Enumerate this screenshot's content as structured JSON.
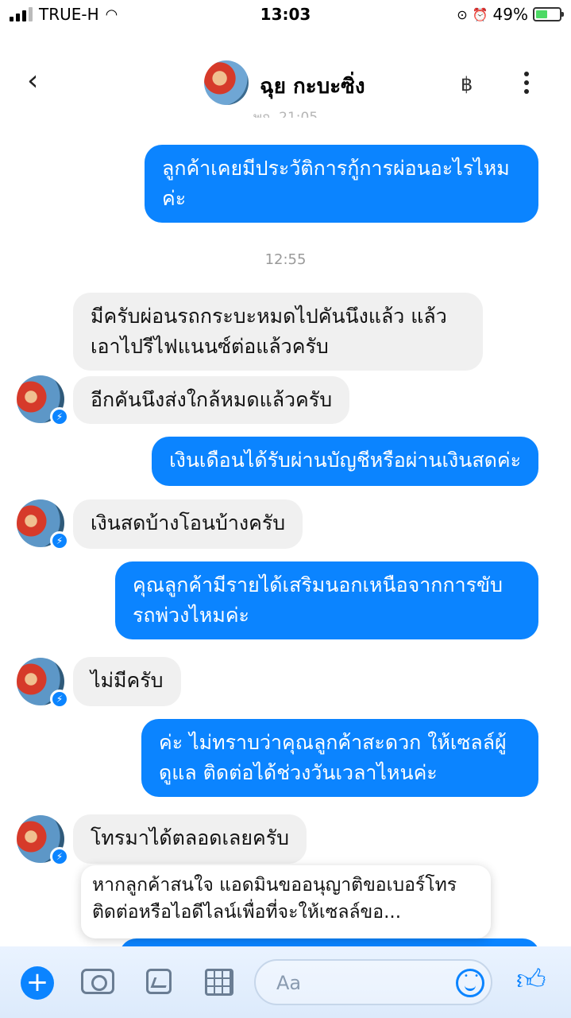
{
  "status_bar": {
    "carrier": "TRUE-H",
    "time": "13:03",
    "battery_percent": "49%",
    "battery_level": 0.49
  },
  "header": {
    "back_icon": "chevron-left-icon",
    "contact_name": "ฉุย กะบะซิ่ง",
    "baht_symbol": "฿",
    "partial_timestamp": "พฤ. 21:05"
  },
  "messages": [
    {
      "side": "out",
      "text": "ลูกค้าเคยมีประวัติการกู้การผ่อนอะไรไหมค่ะ"
    },
    {
      "side": "timestamp",
      "text": "12:55"
    },
    {
      "side": "in",
      "text": "มีครับผ่อนรถกระบะหมดไปคันนึงแล้ว แล้วเอาไปรีไฟแนนซ์ต่อแล้วครับ"
    },
    {
      "side": "in",
      "text": "อีกคันนึงส่งใกล้หมดแล้วครับ"
    },
    {
      "side": "out",
      "text": "เงินเดือนได้รับผ่านบัญชีหรือผ่านเงินสดค่ะ"
    },
    {
      "side": "in",
      "text": "เงินสดบ้างโอนบ้างครับ"
    },
    {
      "side": "out",
      "text": "คุณลูกค้ามีรายได้เสริมนอกเหนือจากการขับรถพ่วงไหมค่ะ"
    },
    {
      "side": "in",
      "text": "ไม่มีครับ"
    },
    {
      "side": "out",
      "text": "ค่ะ ไม่ทราบว่าคุณลูกค้าสะดวก ให้เซลล์ผู้ดูแล ติดต่อได้ช่วงวันเวลาไหนค่ะ"
    },
    {
      "side": "in",
      "text": "โทรมาได้ตลอดเลยครับ"
    }
  ],
  "notice": {
    "text": "หากลูกค้าสนใจ แอดมินขออนุญาติขอเบอร์โทรติดต่อหรือไอดีไลน์เพื่อที่จะให้เซลล์ขอ..."
  },
  "composer": {
    "placeholder": "Aa",
    "icons": [
      "plus-icon",
      "camera-icon",
      "gallery-icon",
      "calculator-icon",
      "emoji-icon",
      "thumbs-up-icon"
    ]
  },
  "colors": {
    "outgoing_bubble": "#0b84ff",
    "incoming_bubble": "#f0f0f0",
    "accent": "#0b84ff"
  }
}
